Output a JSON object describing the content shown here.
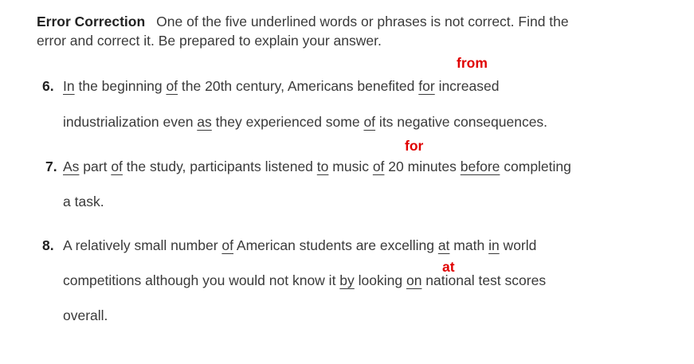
{
  "instructions": {
    "title": "Error Correction",
    "line1": "One of the five underlined words or phrases is not correct. Find the",
    "line2": "error and correct it. Be prepared to explain your answer."
  },
  "items": [
    {
      "number": "6.",
      "line1": {
        "s0": "In",
        "t0": " the beginning ",
        "s1": "of",
        "t1": " the 20th century, Americans benefited ",
        "s2": "for",
        "t2": " increased"
      },
      "line2": {
        "t0": "industrialization even ",
        "s0": "as",
        "t1": " they experienced some ",
        "s1": "of",
        "t2": " its negative consequences."
      },
      "correction": "from"
    },
    {
      "number": "7.",
      "line1": {
        "s0": "As",
        "t0": " part ",
        "s1": "of",
        "t1": " the study, participants listened ",
        "s2": "to",
        "t2": " music ",
        "s3": "of",
        "t3": " 20 minutes ",
        "s4": "before",
        "t4": " completing"
      },
      "line2": {
        "t0": "a task."
      },
      "correction": "for"
    },
    {
      "number": "8.",
      "line1": {
        "t0": "A relatively small number ",
        "s0": "of",
        "t1": " American students are excelling ",
        "s1": "at",
        "t2": " math ",
        "s2": "in",
        "t3": " world"
      },
      "line2": {
        "t0": "competitions although you would not know it ",
        "s0": "by",
        "t1": " looking ",
        "s1": "on",
        "t2": " national test scores"
      },
      "line3": {
        "t0": "overall."
      },
      "correction": "at"
    }
  ]
}
